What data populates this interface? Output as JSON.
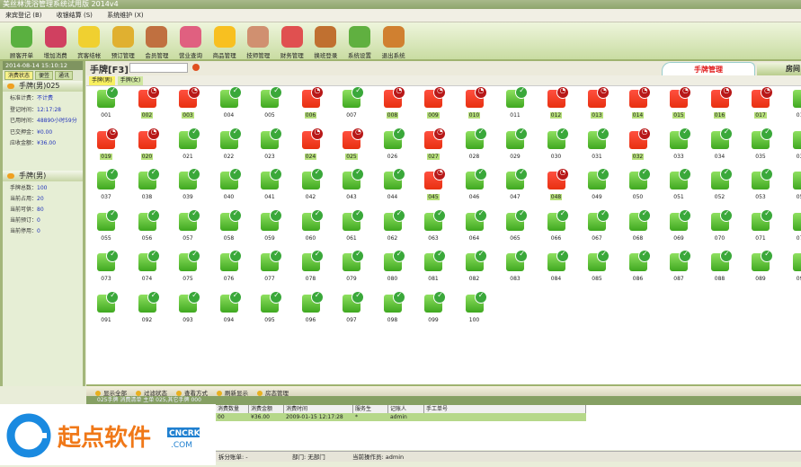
{
  "window": {
    "title": "美丝林洗浴管理系统试用版 2014v4"
  },
  "menu": [
    "来宾登记 (B)",
    "收银结算 (S)",
    "系统维护 (X)"
  ],
  "toolbar": [
    {
      "label": "顾客开单",
      "color": "#5ab040"
    },
    {
      "label": "增加消费",
      "color": "#d04060"
    },
    {
      "label": "宾客结帐",
      "color": "#f0d030"
    },
    {
      "label": "预订管理",
      "color": "#e0b030"
    },
    {
      "label": "会员管理",
      "color": "#c07040"
    },
    {
      "label": "营业查询",
      "color": "#e06080"
    },
    {
      "label": "商品管理",
      "color": "#f8c020"
    },
    {
      "label": "技师管理",
      "color": "#d09070"
    },
    {
      "label": "财务管理",
      "color": "#e05050"
    },
    {
      "label": "换班登录",
      "color": "#c07030"
    },
    {
      "label": "系统设置",
      "color": "#60b040"
    },
    {
      "label": "退出系统",
      "color": "#d08030"
    }
  ],
  "left": {
    "clock": "2014-08-14 15:10:12",
    "tabs": [
      "消费状态",
      "便签",
      "通讯"
    ],
    "card_section": {
      "title": "手牌(男)025",
      "items": [
        {
          "k": "标准计费：",
          "v": "不计费"
        },
        {
          "k": "登记时间：",
          "v": "12:17:28"
        },
        {
          "k": "已用时间：",
          "v": "48890小时59分"
        },
        {
          "k": "已交押金：",
          "v": "¥0.00"
        },
        {
          "k": "应收金额：",
          "v": "¥36.00"
        }
      ]
    },
    "summary": {
      "title": "手牌(男)",
      "items": [
        {
          "k": "手牌总数：",
          "v": "100"
        },
        {
          "k": "当前占用：",
          "v": "20"
        },
        {
          "k": "当前可供：",
          "v": "80"
        },
        {
          "k": "当前预订：",
          "v": "0"
        },
        {
          "k": "当前停用：",
          "v": "0"
        }
      ]
    }
  },
  "main": {
    "title": "手牌[F3]",
    "search": "",
    "tabs": [
      "手牌(男)",
      "手牌(女)"
    ],
    "right_tabs": [
      "手牌管理",
      "房间"
    ],
    "colors": {
      "free": "#3fa820",
      "busy": "#e83010"
    },
    "occupied": [
      "002",
      "003",
      "006",
      "008",
      "009",
      "010",
      "012",
      "013",
      "014",
      "015",
      "016",
      "017",
      "019",
      "020",
      "024",
      "025",
      "027",
      "032",
      "045",
      "048"
    ],
    "cards": [
      "001",
      "002",
      "003",
      "004",
      "005",
      "006",
      "007",
      "008",
      "009",
      "010",
      "011",
      "012",
      "013",
      "014",
      "015",
      "016",
      "017",
      "018",
      "019",
      "020",
      "021",
      "022",
      "023",
      "024",
      "025",
      "026",
      "027",
      "028",
      "029",
      "030",
      "031",
      "032",
      "033",
      "034",
      "035",
      "036",
      "037",
      "038",
      "039",
      "040",
      "041",
      "042",
      "043",
      "044",
      "045",
      "046",
      "047",
      "048",
      "049",
      "050",
      "051",
      "052",
      "053",
      "054",
      "055",
      "056",
      "057",
      "058",
      "059",
      "060",
      "061",
      "062",
      "063",
      "064",
      "065",
      "066",
      "067",
      "068",
      "069",
      "070",
      "071",
      "072",
      "073",
      "074",
      "075",
      "076",
      "077",
      "078",
      "079",
      "080",
      "081",
      "082",
      "083",
      "084",
      "085",
      "086",
      "087",
      "088",
      "089",
      "090",
      "091",
      "092",
      "093",
      "094",
      "095",
      "096",
      "097",
      "098",
      "099",
      "100"
    ]
  },
  "bottom_toolbar": [
    "显示全部",
    "过滤状态",
    "查看方式",
    "刷新显示",
    "房态管理"
  ],
  "strip": "025手牌  消费清单  主单 025,其它手牌 000",
  "table": {
    "columns": [
      "消费数量",
      "消费金额",
      "消费时间",
      "服务生",
      "记账人",
      "手工单号"
    ],
    "rows": [
      [
        "00",
        "¥36.00",
        "2009-01-15 12:17:28",
        "*",
        "admin",
        ""
      ]
    ]
  },
  "status": {
    "split": "拆分账单: -",
    "dept": "部门: 无部门",
    "operator": "当前操作员: admin"
  },
  "watermark": {
    "text": "起点软件",
    "sub": "CNCRK",
    ".com": ".COM"
  }
}
